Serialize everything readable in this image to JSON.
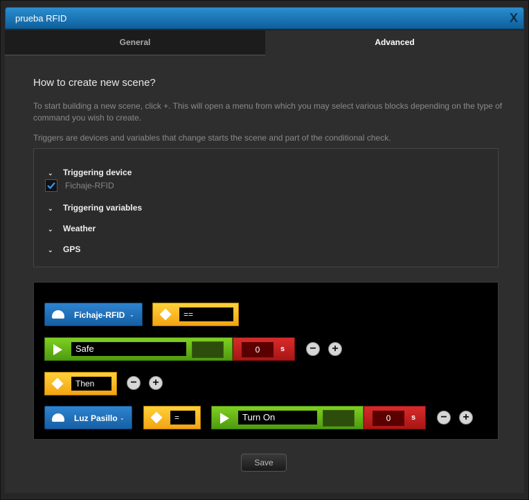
{
  "window": {
    "title": "prueba RFID",
    "close_label": "X"
  },
  "tabs": [
    {
      "label": "General"
    },
    {
      "label": "Advanced"
    }
  ],
  "main": {
    "heading": "How to create new scene?",
    "desc1": "To start building a new scene, click +. This will open a menu from which you may select various blocks depending on the type of command you wish to create.",
    "desc2": "Triggers are devices and variables that change starts the scene and part of the conditional check."
  },
  "triggers": {
    "device_label": "Triggering device",
    "device_item": "Fichaje-RFID",
    "device_item_checked": true,
    "variables_label": "Triggering variables",
    "weather_label": "Weather",
    "gps_label": "GPS"
  },
  "scene": {
    "row1": {
      "device": "Fichaje-RFID",
      "operator": "=="
    },
    "row2": {
      "value": "Safe",
      "delay": "0",
      "unit": "s"
    },
    "row3": {
      "keyword": "Then"
    },
    "row4": {
      "device": "Luz Pasillo",
      "operator": "=",
      "action": "Turn On",
      "delay": "0",
      "unit": "s"
    }
  },
  "footer": {
    "save_label": "Save"
  },
  "colors": {
    "titlebar": "#1a72b8",
    "block_blue": "#2f83cf",
    "block_yellow": "#f8bb22",
    "block_green": "#6cbf1c",
    "block_red": "#c41f1f"
  }
}
